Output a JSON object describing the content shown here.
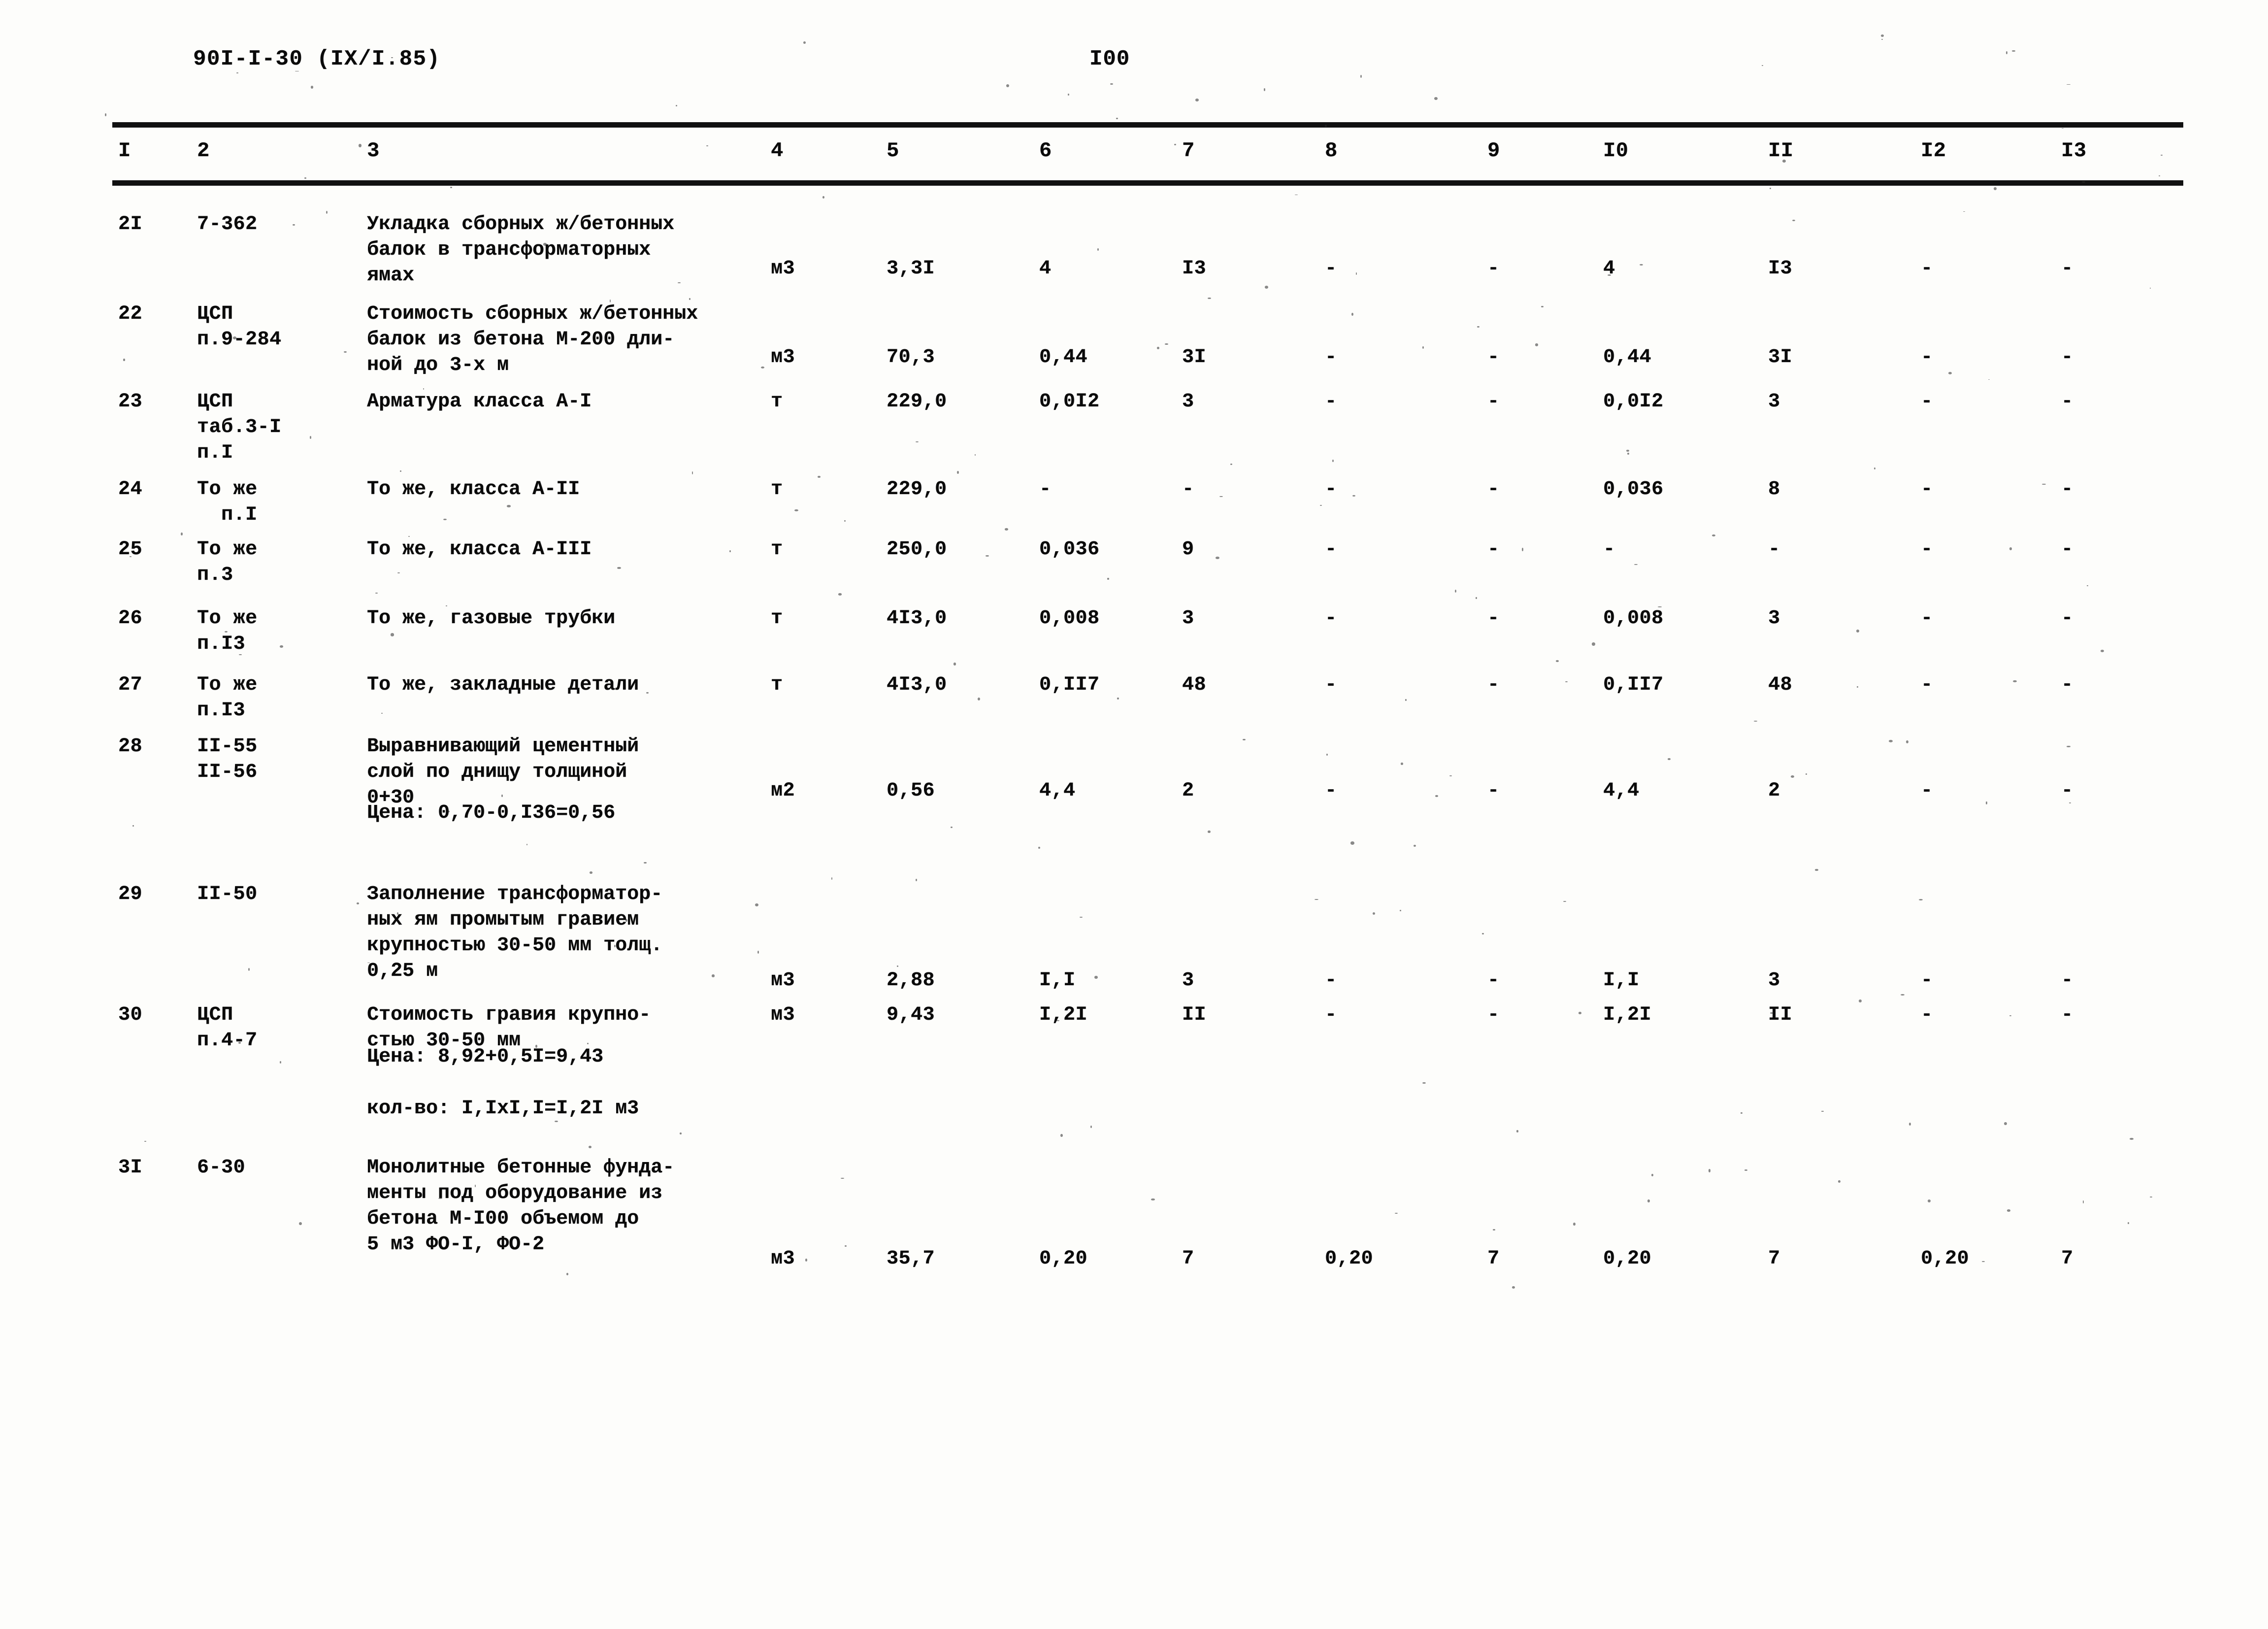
{
  "header": {
    "doc_code": "90I-I-30 (IX/I.85)",
    "page_number": "I00"
  },
  "table": {
    "column_headers": [
      "I",
      "2",
      "3",
      "4",
      "5",
      "6",
      "7",
      "8",
      "9",
      "I0",
      "II",
      "I2",
      "I3"
    ],
    "rows": [
      {
        "no": "2I",
        "code": "7-362",
        "description": [
          "Укладка сборных ж/бетонных",
          "балок в трансформаторных",
          "ямах"
        ],
        "note": "",
        "unit": "м3",
        "c5": "3,3I",
        "c6": "4",
        "c7": "I3",
        "c8": "-",
        "c9": "-",
        "c10": "4",
        "c11": "I3",
        "c12": "-",
        "c13": "-"
      },
      {
        "no": "22",
        "code": "ЦСП\nп.9-284",
        "description": [
          "Стоимость сборных ж/бетонных",
          "балок из бетона М-200 дли-",
          "ной до 3-х м"
        ],
        "note": "",
        "unit": "м3",
        "c5": "70,3",
        "c6": "0,44",
        "c7": "3I",
        "c8": "-",
        "c9": "-",
        "c10": "0,44",
        "c11": "3I",
        "c12": "-",
        "c13": "-"
      },
      {
        "no": "23",
        "code": "ЦСП\nтаб.3-I\nп.I",
        "description": [
          "Арматура класса А-I"
        ],
        "note": "",
        "unit": "т",
        "c5": "229,0",
        "c6": "0,0I2",
        "c7": "3",
        "c8": "-",
        "c9": "-",
        "c10": "0,0I2",
        "c11": "3",
        "c12": "-",
        "c13": "-"
      },
      {
        "no": "24",
        "code": "То же\n  п.I",
        "description": [
          "То же, класса А-II"
        ],
        "note": "",
        "unit": "т",
        "c5": "229,0",
        "c6": "-",
        "c7": "-",
        "c8": "-",
        "c9": "-",
        "c10": "0,036",
        "c11": "8",
        "c12": "-",
        "c13": "-"
      },
      {
        "no": "25",
        "code": "То же\nп.3",
        "description": [
          "То же, класса А-III"
        ],
        "note": "",
        "unit": "т",
        "c5": "250,0",
        "c6": "0,036",
        "c7": "9",
        "c8": "-",
        "c9": "-",
        "c10": "-",
        "c11": "-",
        "c12": "-",
        "c13": "-"
      },
      {
        "no": "26",
        "code": "То же\nп.I3",
        "description": [
          "То же, газовые трубки"
        ],
        "note": "",
        "unit": "т",
        "c5": "4I3,0",
        "c6": "0,008",
        "c7": "3",
        "c8": "-",
        "c9": "-",
        "c10": "0,008",
        "c11": "3",
        "c12": "-",
        "c13": "-"
      },
      {
        "no": "27",
        "code": "То же\nп.I3",
        "description": [
          "То же, закладные детали"
        ],
        "note": "",
        "unit": "т",
        "c5": "4I3,0",
        "c6": "0,II7",
        "c7": "48",
        "c8": "-",
        "c9": "-",
        "c10": "0,II7",
        "c11": "48",
        "c12": "-",
        "c13": "-"
      },
      {
        "no": "28",
        "code": "II-55\nII-56",
        "description": [
          "Выравнивающий цементный",
          "слой по днищу толщиной",
          "0+30"
        ],
        "note": "Цена: 0,70-0,I36=0,56",
        "unit": "м2",
        "c5": "0,56",
        "c6": "4,4",
        "c7": "2",
        "c8": "-",
        "c9": "-",
        "c10": "4,4",
        "c11": "2",
        "c12": "-",
        "c13": "-"
      },
      {
        "no": "29",
        "code": "II-50",
        "description": [
          "Заполнение трансформатор-",
          "ных ям промытым гравием",
          "крупностью 30-50 мм толщ.",
          "0,25 м"
        ],
        "note": "",
        "unit": "м3",
        "c5": "2,88",
        "c6": "I,I",
        "c7": "3",
        "c8": "-",
        "c9": "-",
        "c10": "I,I",
        "c11": "3",
        "c12": "-",
        "c13": "-"
      },
      {
        "no": "30",
        "code": "ЦСП\nп.4-7",
        "description": [
          "Стоимость гравия крупно-",
          "стью 30-50 мм"
        ],
        "note": "Цена: 8,92+0,5I=9,43",
        "note2": "кол-во: I,IxI,I=I,2I м3",
        "unit": "м3",
        "c5": "9,43",
        "c6": "I,2I",
        "c7": "II",
        "c8": "-",
        "c9": "-",
        "c10": "I,2I",
        "c11": "II",
        "c12": "-",
        "c13": "-"
      },
      {
        "no": "3I",
        "code": "6-30",
        "description": [
          "Монолитные бетонные фунда-",
          "менты под оборудование из",
          "бетона М-I00 объемом до",
          "5 м3 ФО-I, ФО-2"
        ],
        "note": "",
        "unit": "м3",
        "c5": "35,7",
        "c6": "0,20",
        "c7": "7",
        "c8": "0,20",
        "c9": "7",
        "c10": "0,20",
        "c11": "7",
        "c12": "0,20",
        "c13": "7"
      }
    ]
  }
}
